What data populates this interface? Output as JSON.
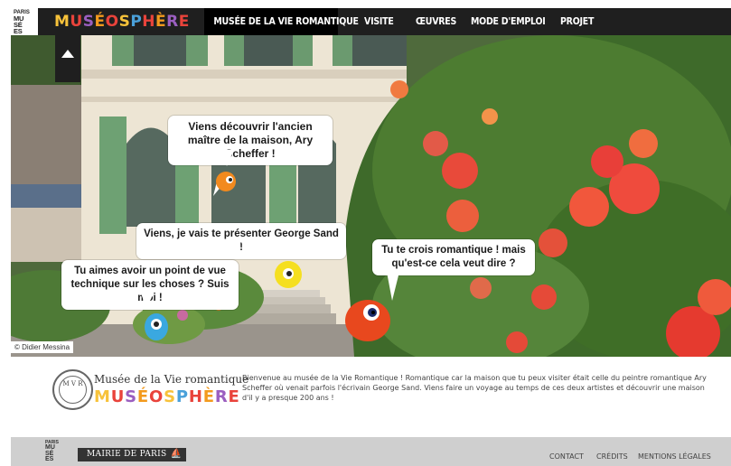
{
  "header": {
    "paris_logo": {
      "top": "PARIS",
      "line1": "MU",
      "line2": "SÉ",
      "line3": "ES"
    },
    "brand_letters": [
      "M",
      "U",
      "S",
      "É",
      "O",
      "S",
      "P",
      "H",
      "È",
      "R",
      "E"
    ],
    "brand_colors": [
      "#f7c23a",
      "#e9433b",
      "#9b5fc0",
      "#f39a1d",
      "#e9433b",
      "#f7c23a",
      "#4aa0d9",
      "#e9433b",
      "#f39a1d",
      "#9b5fc0",
      "#e9433b"
    ],
    "nav": [
      {
        "label": "Musée de la Vie romantique",
        "active": true
      },
      {
        "label": "Visite",
        "active": false
      },
      {
        "label": "Œuvres",
        "active": false
      },
      {
        "label": "Mode d'emploi",
        "active": false
      },
      {
        "label": "Projet",
        "active": false
      }
    ]
  },
  "hero": {
    "up_icon": "triangle-up-icon",
    "bubbles": [
      {
        "text": "Viens découvrir l'ancien maître de la maison, Ary Scheffer !"
      },
      {
        "text": "Viens, je vais te présenter George Sand !"
      },
      {
        "text": "Tu aimes avoir un point de vue technique sur les choses ? Suis moi !"
      },
      {
        "text": "Tu te crois romantique ! mais qu'est-ce cela veut dire ?"
      }
    ],
    "credit": "© Didier Messina",
    "characters": [
      {
        "name": "orange-bird",
        "color": "#f28a1e"
      },
      {
        "name": "yellow-blob",
        "color": "#f5df1f"
      },
      {
        "name": "blue-blob",
        "color": "#3aa8e0"
      },
      {
        "name": "red-blob",
        "color": "#e8481e"
      }
    ]
  },
  "intro": {
    "seal_text": "M V R",
    "museum_name": "Musée de la Vie romantique",
    "text": "Bienvenue au musée de la Vie Romantique ! Romantique car la maison que tu peux visiter était celle du peintre romantique Ary Scheffer où venait parfois l'écrivain George Sand. Viens faire un voyage au temps de ces deux artistes et découvrir une maison d'il y a presque 200 ans !"
  },
  "footer": {
    "paris_logo": {
      "top": "PARIS",
      "line1": "MU",
      "line2": "SÉ",
      "line3": "ES"
    },
    "mairie": "MAIRIE DE PARIS",
    "mairie_icon": "paris-boat-icon",
    "links": [
      "Contact",
      "Crédits",
      "Mentions légales"
    ]
  }
}
